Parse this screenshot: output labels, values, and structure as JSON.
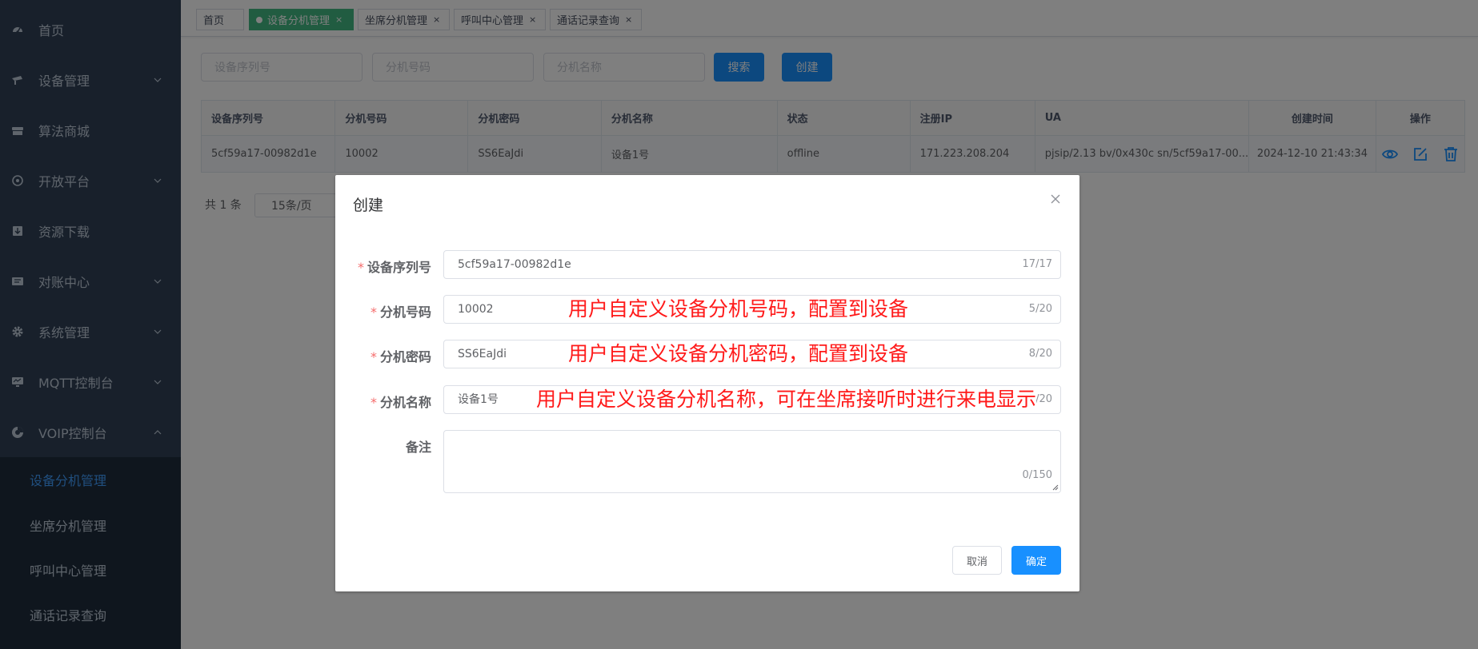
{
  "sidebar": {
    "items": [
      {
        "label": "首页",
        "icon": "dashboard-icon"
      },
      {
        "label": "设备管理",
        "icon": "device-icon"
      },
      {
        "label": "算法商城",
        "icon": "store-icon"
      },
      {
        "label": "开放平台",
        "icon": "platform-icon"
      },
      {
        "label": "资源下载",
        "icon": "download-icon"
      },
      {
        "label": "对账中心",
        "icon": "billing-icon"
      },
      {
        "label": "系统管理",
        "icon": "gear-icon"
      },
      {
        "label": "MQTT控制台",
        "icon": "monitor-icon"
      },
      {
        "label": "VOIP控制台",
        "icon": "voip-icon"
      }
    ],
    "submenu": [
      {
        "label": "设备分机管理",
        "active": true
      },
      {
        "label": "坐席分机管理",
        "active": false
      },
      {
        "label": "呼叫中心管理",
        "active": false
      },
      {
        "label": "通话记录查询",
        "active": false
      }
    ]
  },
  "tags": [
    {
      "label": "首页"
    },
    {
      "label": "设备分机管理"
    },
    {
      "label": "坐席分机管理"
    },
    {
      "label": "呼叫中心管理"
    },
    {
      "label": "通话记录查询"
    }
  ],
  "search": {
    "serial_placeholder": "设备序列号",
    "ext_number_placeholder": "分机号码",
    "ext_name_placeholder": "分机名称",
    "search_label": "搜索",
    "create_label": "创建"
  },
  "table": {
    "columns": [
      "设备序列号",
      "分机号码",
      "分机密码",
      "分机名称",
      "状态",
      "注册IP",
      "UA",
      "创建时间",
      "操作"
    ],
    "rows": [
      [
        "5cf59a17-00982d1e",
        "10002",
        "SS6EaJdi",
        "设备1号",
        "offline",
        "171.223.208.204",
        "pjsip/2.13 bv/0x430c sn/5cf59a17-00...",
        "2024-12-10 21:43:34"
      ]
    ]
  },
  "pager": {
    "total": "共 1 条",
    "size": "15条/页"
  },
  "dialog": {
    "title": "创建",
    "fields": [
      {
        "label": "设备序列号",
        "value": "5cf59a17-00982d1e",
        "count": "17/17"
      },
      {
        "label": "分机号码",
        "value": "10002",
        "count": "5/20"
      },
      {
        "label": "分机密码",
        "value": "SS6EaJdi",
        "count": "8/20"
      },
      {
        "label": "分机名称",
        "value": "设备1号",
        "count": "4/20"
      }
    ],
    "remark": {
      "label": "备注",
      "count": "0/150"
    },
    "cancel_label": "取消",
    "ok_label": "确定"
  },
  "annotations": {
    "ext_number": "用户自定义设备分机号码，配置到设备",
    "ext_password": "用户自定义设备分机密码，配置到设备",
    "ext_name": "用户自定义设备分机名称，可在坐席接听时进行来电显示"
  },
  "colors": {
    "sidebar_bg": "#304156",
    "submenu_bg": "#1f2d3d",
    "active_tag": "#42b983",
    "primary": "#1890ff",
    "annotation": "#ff1a1a"
  }
}
